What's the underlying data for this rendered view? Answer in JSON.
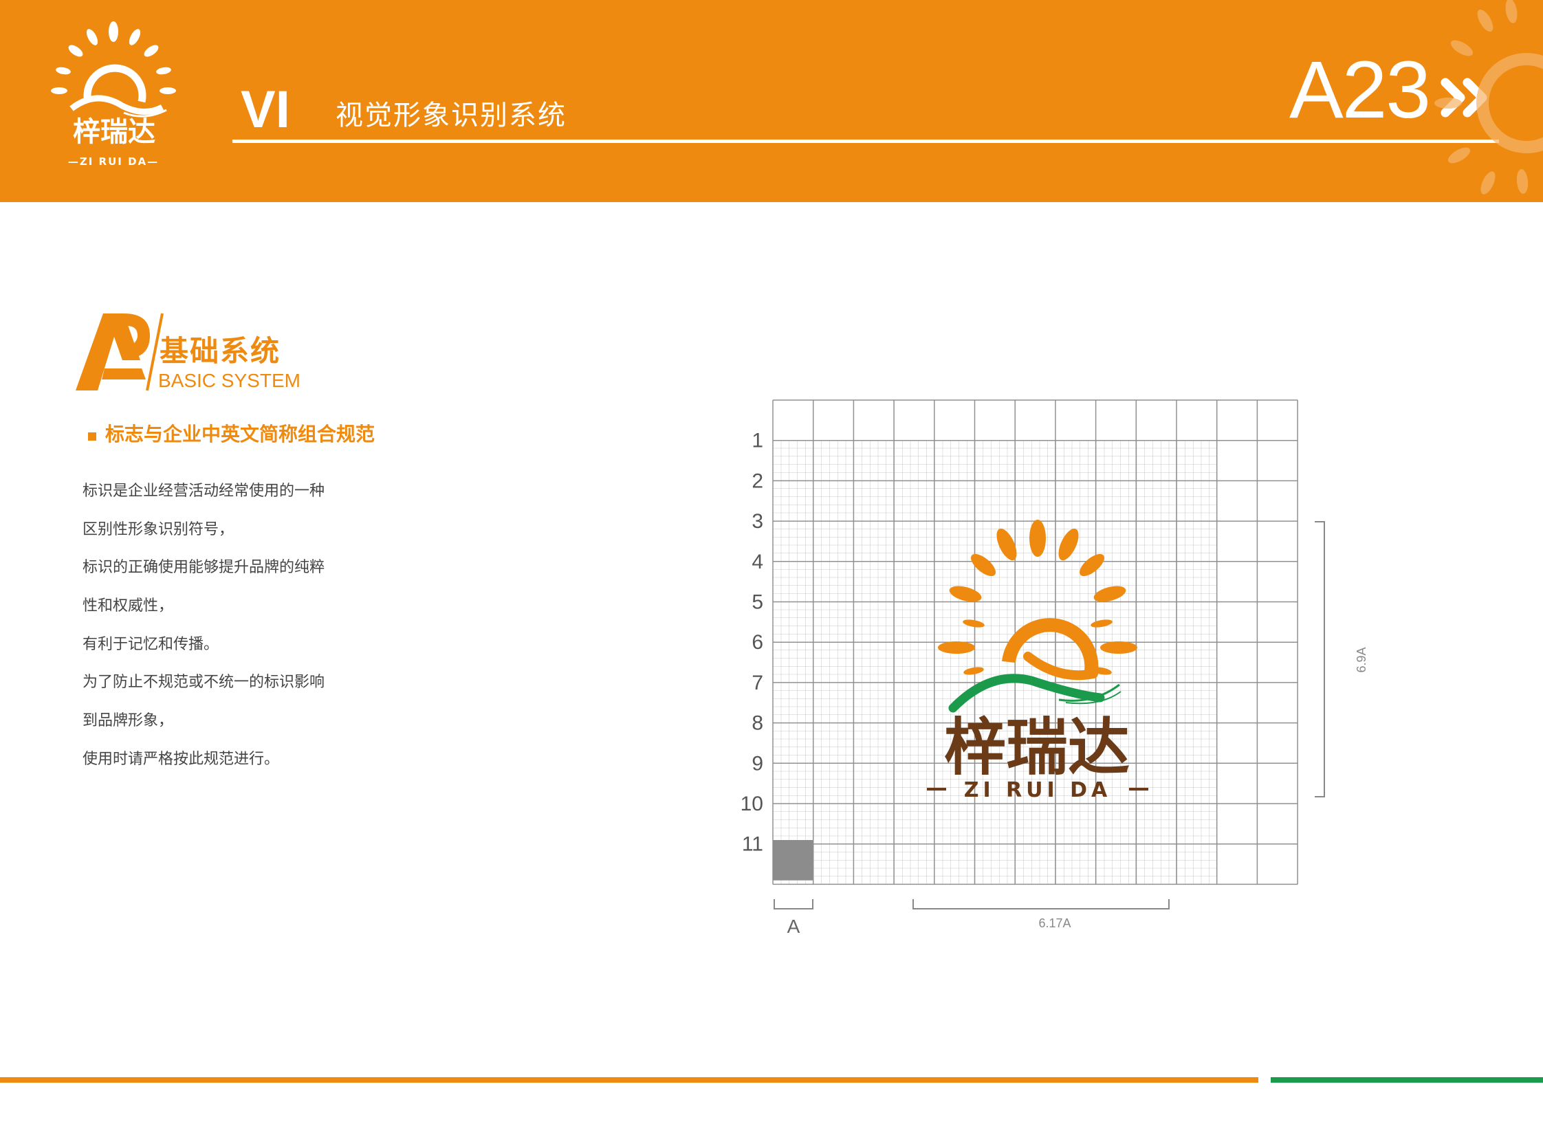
{
  "colors": {
    "brand_orange": "#ee8a10",
    "brand_green": "#1a9a4a",
    "brand_brown": "#6b3a17",
    "grid_gray": "#909090"
  },
  "header": {
    "logo": {
      "name_cn": "梓瑞达",
      "name_en": "—ZI RUI DA—",
      "icon": "sun-logo-icon"
    },
    "vi_label": "VI",
    "subtitle": "视觉形象识别系统",
    "page_code": "A23",
    "arrow_icon": "double-chevron-right-icon"
  },
  "section": {
    "mark_letter": "A",
    "title": "基础系统",
    "subtitle": "BASIC SYSTEM"
  },
  "spec": {
    "title": "标志与企业中英文简称组合规范",
    "description_lines": [
      "标识是企业经营活动经常使用的一种",
      "区别性形象识别符号，",
      "标识的正确使用能够提升品牌的纯粹",
      "性和权威性，",
      "有利于记忆和传播。",
      "为了防止不规范或不统一的标识影响",
      "到品牌形象，",
      "使用时请严格按此规范进行。"
    ]
  },
  "grid": {
    "columns": 13,
    "rows": 12,
    "row_labels": [
      "1",
      "2",
      "3",
      "4",
      "5",
      "6",
      "7",
      "8",
      "9",
      "10",
      "11"
    ],
    "unit_label": "A",
    "width_label": "6.17A",
    "height_label": "6.9A",
    "logo": {
      "name_cn": "梓瑞达",
      "name_en": "ZI RUI DA"
    }
  }
}
